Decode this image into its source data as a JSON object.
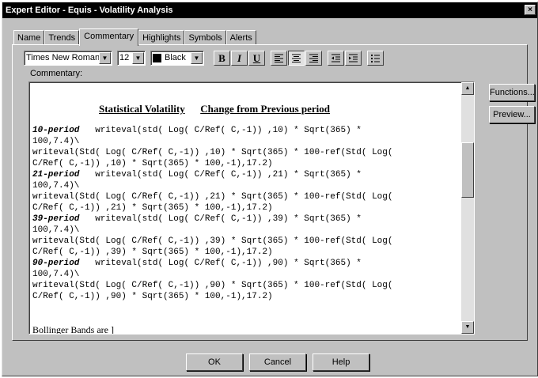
{
  "window": {
    "title": "Expert Editor - Equis - Volatility Analysis",
    "close": "×"
  },
  "tabs": [
    "Name",
    "Trends",
    "Commentary",
    "Highlights",
    "Symbols",
    "Alerts"
  ],
  "toolbar": {
    "font": "Times New Roman",
    "size": "12",
    "color": "Black",
    "bold": "B",
    "italic": "I",
    "underline": "U"
  },
  "commentary_label": "Commentary:",
  "editor": {
    "heading_left": "Statistical Volatility",
    "heading_right": "Change from Previous period",
    "blocks": [
      {
        "period": "10-period",
        "lines": [
          "   writeval(std( Log( C/Ref( C,-1)) ,10) * Sqrt(365) *",
          "100,7.4)\\",
          "writeval(Std( Log( C/Ref( C,-1)) ,10) * Sqrt(365) * 100-ref(Std( Log(",
          "C/Ref( C,-1)) ,10) * Sqrt(365) * 100,-1),17.2)"
        ]
      },
      {
        "period": "21-period",
        "lines": [
          "   writeval(std( Log( C/Ref( C,-1)) ,21) * Sqrt(365) *",
          "100,7.4)\\",
          "writeval(Std( Log( C/Ref( C,-1)) ,21) * Sqrt(365) * 100-ref(Std( Log(",
          "C/Ref( C,-1)) ,21) * Sqrt(365) * 100,-1),17.2)"
        ]
      },
      {
        "period": "39-period",
        "lines": [
          "   writeval(std( Log( C/Ref( C,-1)) ,39) * Sqrt(365) *",
          "100,7.4)\\",
          "writeval(Std( Log( C/Ref( C,-1)) ,39) * Sqrt(365) * 100-ref(Std( Log(",
          "C/Ref( C,-1)) ,39) * Sqrt(365) * 100,-1),17.2)"
        ]
      },
      {
        "period": "90-period",
        "lines": [
          "   writeval(std( Log( C/Ref( C,-1)) ,90) * Sqrt(365) *",
          "100,7.4)\\",
          "writeval(Std( Log( C/Ref( C,-1)) ,90) * Sqrt(365) * 100-ref(Std( Log(",
          "C/Ref( C,-1)) ,90) * Sqrt(365) * 100,-1),17.2)"
        ]
      }
    ],
    "cut_line": "Bollinger Bands are ]"
  },
  "side_buttons": {
    "functions": "Functions...",
    "preview": "Preview..."
  },
  "bottom_buttons": {
    "ok": "OK",
    "cancel": "Cancel",
    "help": "Help"
  }
}
